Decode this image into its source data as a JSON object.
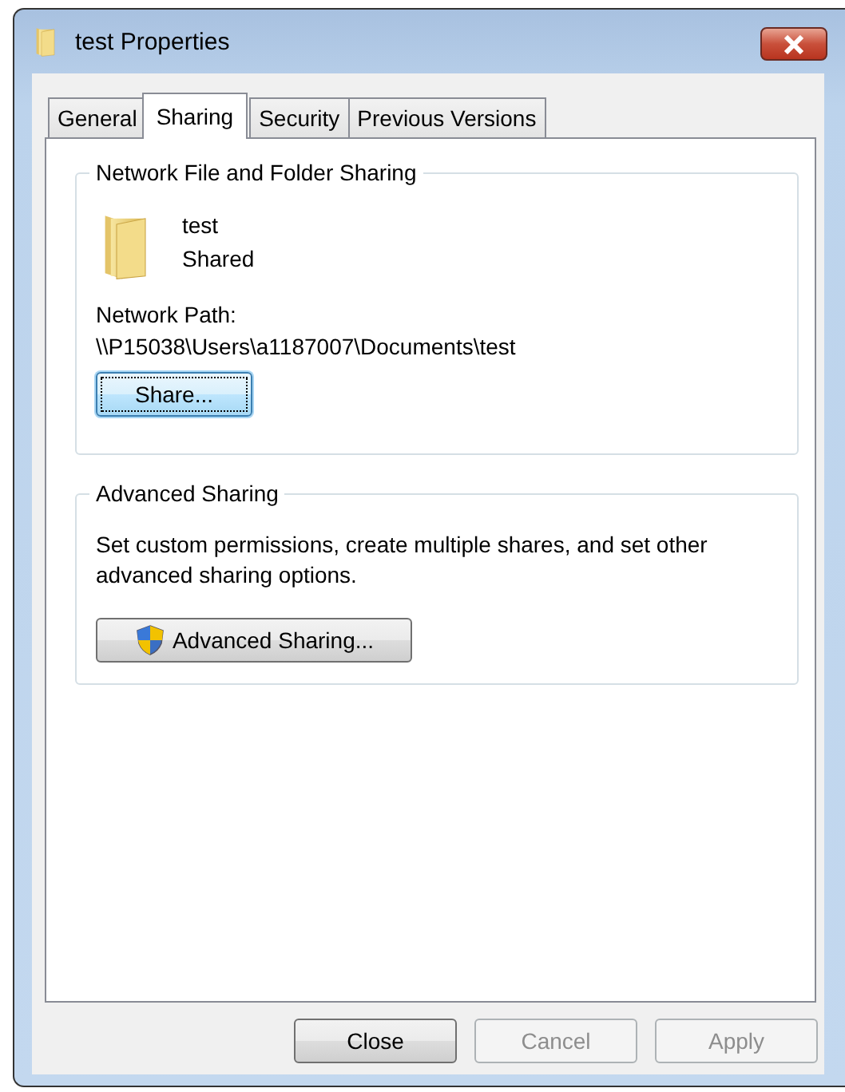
{
  "window": {
    "title": "test Properties"
  },
  "tabs": [
    {
      "label": "General",
      "selected": false
    },
    {
      "label": "Sharing",
      "selected": true
    },
    {
      "label": "Security",
      "selected": false
    },
    {
      "label": "Previous Versions",
      "selected": false
    }
  ],
  "network_sharing": {
    "title": "Network File and Folder Sharing",
    "folder_name": "test",
    "folder_status": "Shared",
    "path_label": "Network Path:",
    "path": "\\\\P15038\\Users\\a1187007\\Documents\\test",
    "button": {
      "label": "Share...",
      "focused": true
    }
  },
  "advanced_sharing": {
    "title": "Advanced Sharing",
    "description": "Set custom permissions, create multiple shares, and set other advanced sharing options.",
    "button": {
      "label": "Advanced Sharing...",
      "focused": false
    }
  },
  "buttons": [
    {
      "label": "Close",
      "disabled": false
    },
    {
      "label": "Cancel",
      "disabled": true
    },
    {
      "label": "Apply",
      "disabled": true
    }
  ]
}
